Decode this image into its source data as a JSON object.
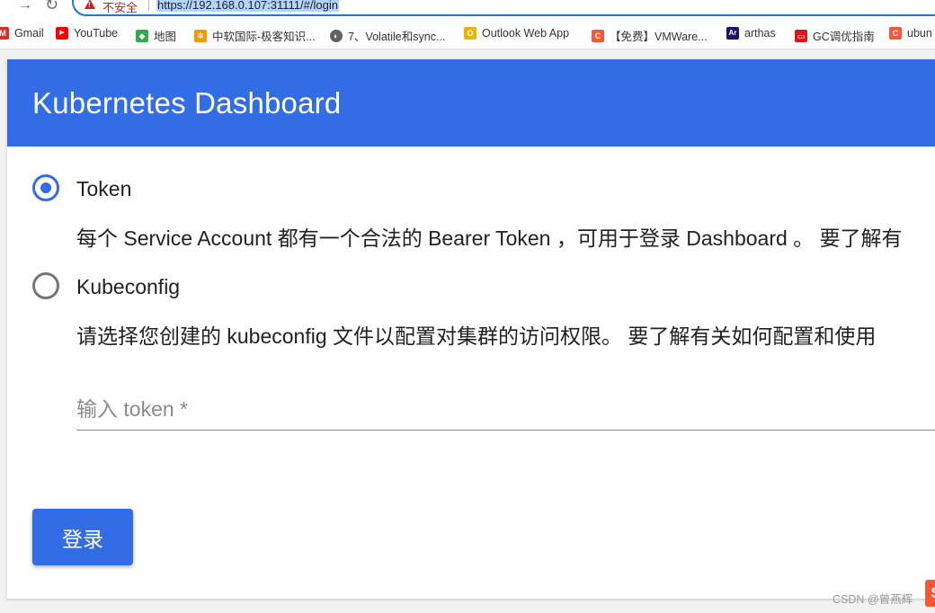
{
  "browser": {
    "back_icon": "←",
    "forward_icon": "→",
    "reload_icon": "↻",
    "insecure_label": "不安全",
    "url": "https://192.168.0.107:31111/#/login"
  },
  "bookmarks": [
    {
      "label": "Gmail",
      "icon": "gmail-icon",
      "glyph": "M",
      "color": "#d93025"
    },
    {
      "label": "YouTube",
      "icon": "youtube-icon",
      "glyph": "▶",
      "color": "#ff0000"
    },
    {
      "label": "地图",
      "icon": "maps-icon",
      "glyph": "◆",
      "color": "#34a853"
    },
    {
      "label": "中软国际-极客知识...",
      "icon": "chinasoft-icon",
      "glyph": "✻",
      "color": "#f29900"
    },
    {
      "label": "7、Volatile和sync...",
      "icon": "globe-icon",
      "glyph": "◐",
      "color": "#5f6368"
    },
    {
      "label": "Outlook Web App",
      "icon": "outlook-icon",
      "glyph": "O",
      "color": "#f0b400"
    },
    {
      "label": "【免费】VMWare...",
      "icon": "csdn-icon",
      "glyph": "C",
      "color": "#fc5531"
    },
    {
      "label": "arthas",
      "icon": "arthas-icon",
      "glyph": "Ar",
      "color": "#1b1464"
    },
    {
      "label": "GC调优指南",
      "icon": "oracle-icon",
      "glyph": "▭",
      "color": "#d7191c"
    },
    {
      "label": "ubun",
      "icon": "csdn-icon",
      "glyph": "C",
      "color": "#fc5531"
    }
  ],
  "header": {
    "title": "Kubernetes Dashboard"
  },
  "login": {
    "token_option": {
      "label": "Token",
      "description": "每个 Service Account 都有一个合法的 Bearer Token ，可用于登录 Dashboard 。 要了解有"
    },
    "kubeconfig_option": {
      "label": "Kubeconfig",
      "description": "请选择您创建的 kubeconfig 文件以配置对集群的访问权限。 要了解有关如何配置和使用"
    },
    "token_input": {
      "placeholder": "输入 token *",
      "value": ""
    },
    "signin_label": "登录"
  },
  "watermark": {
    "text": "CSDN @曾燕辉",
    "logo": "S"
  }
}
